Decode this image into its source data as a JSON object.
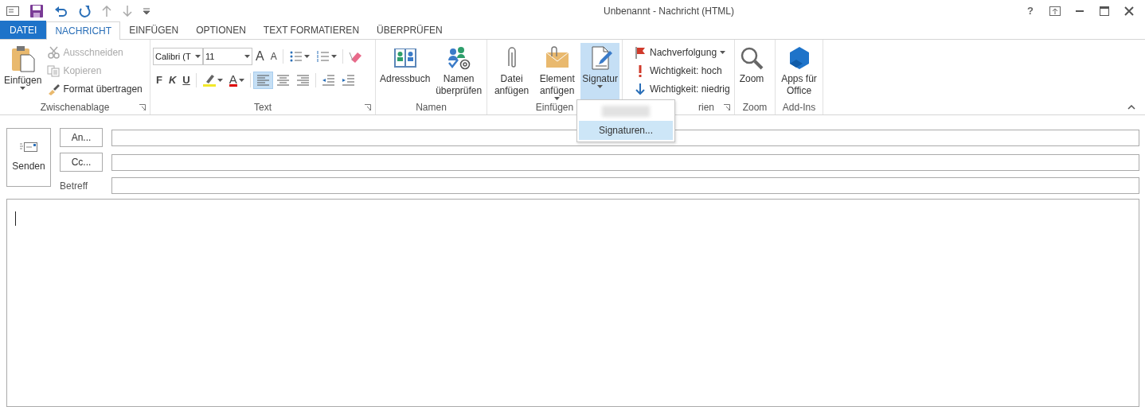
{
  "window": {
    "title": "Unbenannt - Nachricht (HTML)",
    "help": "?"
  },
  "tabs": [
    {
      "label": "DATEI",
      "kind": "file",
      "selected": false
    },
    {
      "label": "NACHRICHT",
      "kind": "tab",
      "selected": true
    },
    {
      "label": "EINFÜGEN",
      "kind": "tab",
      "selected": false
    },
    {
      "label": "OPTIONEN",
      "kind": "tab",
      "selected": false
    },
    {
      "label": "TEXT FORMATIEREN",
      "kind": "tab",
      "selected": false
    },
    {
      "label": "ÜBERPRÜFEN",
      "kind": "tab",
      "selected": false
    }
  ],
  "clipboard": {
    "label": "Zwischenablage",
    "paste": "Einfügen",
    "items": [
      {
        "kind": "cut",
        "label": "Ausschneiden",
        "disabled": true
      },
      {
        "kind": "copy",
        "label": "Kopieren",
        "disabled": true
      },
      {
        "kind": "brush",
        "label": "Format übertragen",
        "disabled": false
      }
    ]
  },
  "text_group": {
    "label": "Text",
    "font": "Calibri (T",
    "size": "11",
    "row1": [
      {
        "kind": "grow",
        "glyph": "A"
      },
      {
        "kind": "shrink",
        "glyph": "A"
      },
      {
        "kind": "sep"
      },
      {
        "kind": "bullets"
      },
      {
        "kind": "numbering"
      },
      {
        "kind": "sep"
      },
      {
        "kind": "clear"
      }
    ],
    "row2": [
      {
        "kind": "bold",
        "glyph": "F"
      },
      {
        "kind": "italic",
        "glyph": "K"
      },
      {
        "kind": "underline",
        "glyph": "U"
      },
      {
        "kind": "sep"
      },
      {
        "kind": "highlight"
      },
      {
        "kind": "fontcolor",
        "glyph": "A"
      },
      {
        "kind": "sep"
      },
      {
        "kind": "align_left",
        "selected": true
      },
      {
        "kind": "align_center",
        "selected": false
      },
      {
        "kind": "align_right",
        "selected": false
      },
      {
        "kind": "sep"
      },
      {
        "kind": "outdent"
      },
      {
        "kind": "indent"
      }
    ]
  },
  "names_group": {
    "label": "Namen",
    "buttons": [
      {
        "kind": "book",
        "label": "Adressbuch",
        "dropdown": false,
        "pressed": false
      },
      {
        "kind": "checknames",
        "label": "Namen überprüfen",
        "dropdown": false,
        "pressed": false
      }
    ]
  },
  "insert_group": {
    "label": "Einfügen",
    "buttons": [
      {
        "kind": "clip",
        "label": "Datei anfügen",
        "dropdown": false,
        "pressed": false
      },
      {
        "kind": "envelope",
        "label": "Element anfügen",
        "dropdown": true,
        "pressed": false
      },
      {
        "kind": "signature",
        "label": "Signatur",
        "dropdown": true,
        "pressed": true
      }
    ]
  },
  "tags_group": {
    "label": "rien",
    "items": [
      {
        "kind": "flag",
        "label": "Nachverfolgung",
        "dropdown": true
      },
      {
        "kind": "high",
        "label": "Wichtigkeit: hoch",
        "dropdown": false
      },
      {
        "kind": "low",
        "label": "Wichtigkeit: niedrig",
        "dropdown": false
      }
    ]
  },
  "zoom_group": {
    "label": "Zoom",
    "buttons": [
      {
        "kind": "zoom",
        "label": "Zoom",
        "dropdown": false,
        "pressed": false
      }
    ]
  },
  "addins_group": {
    "label": "Add-Ins",
    "buttons": [
      {
        "kind": "apps",
        "label": "Apps für Office",
        "dropdown": false,
        "pressed": false
      }
    ]
  },
  "signature_menu": {
    "items": [
      {
        "kind": "redacted",
        "highlighted": false
      },
      {
        "kind": "item",
        "label": "Signaturen...",
        "highlighted": true
      }
    ]
  },
  "compose": {
    "send": "Senden",
    "to": "An...",
    "cc": "Cc...",
    "subject": "Betreff"
  }
}
